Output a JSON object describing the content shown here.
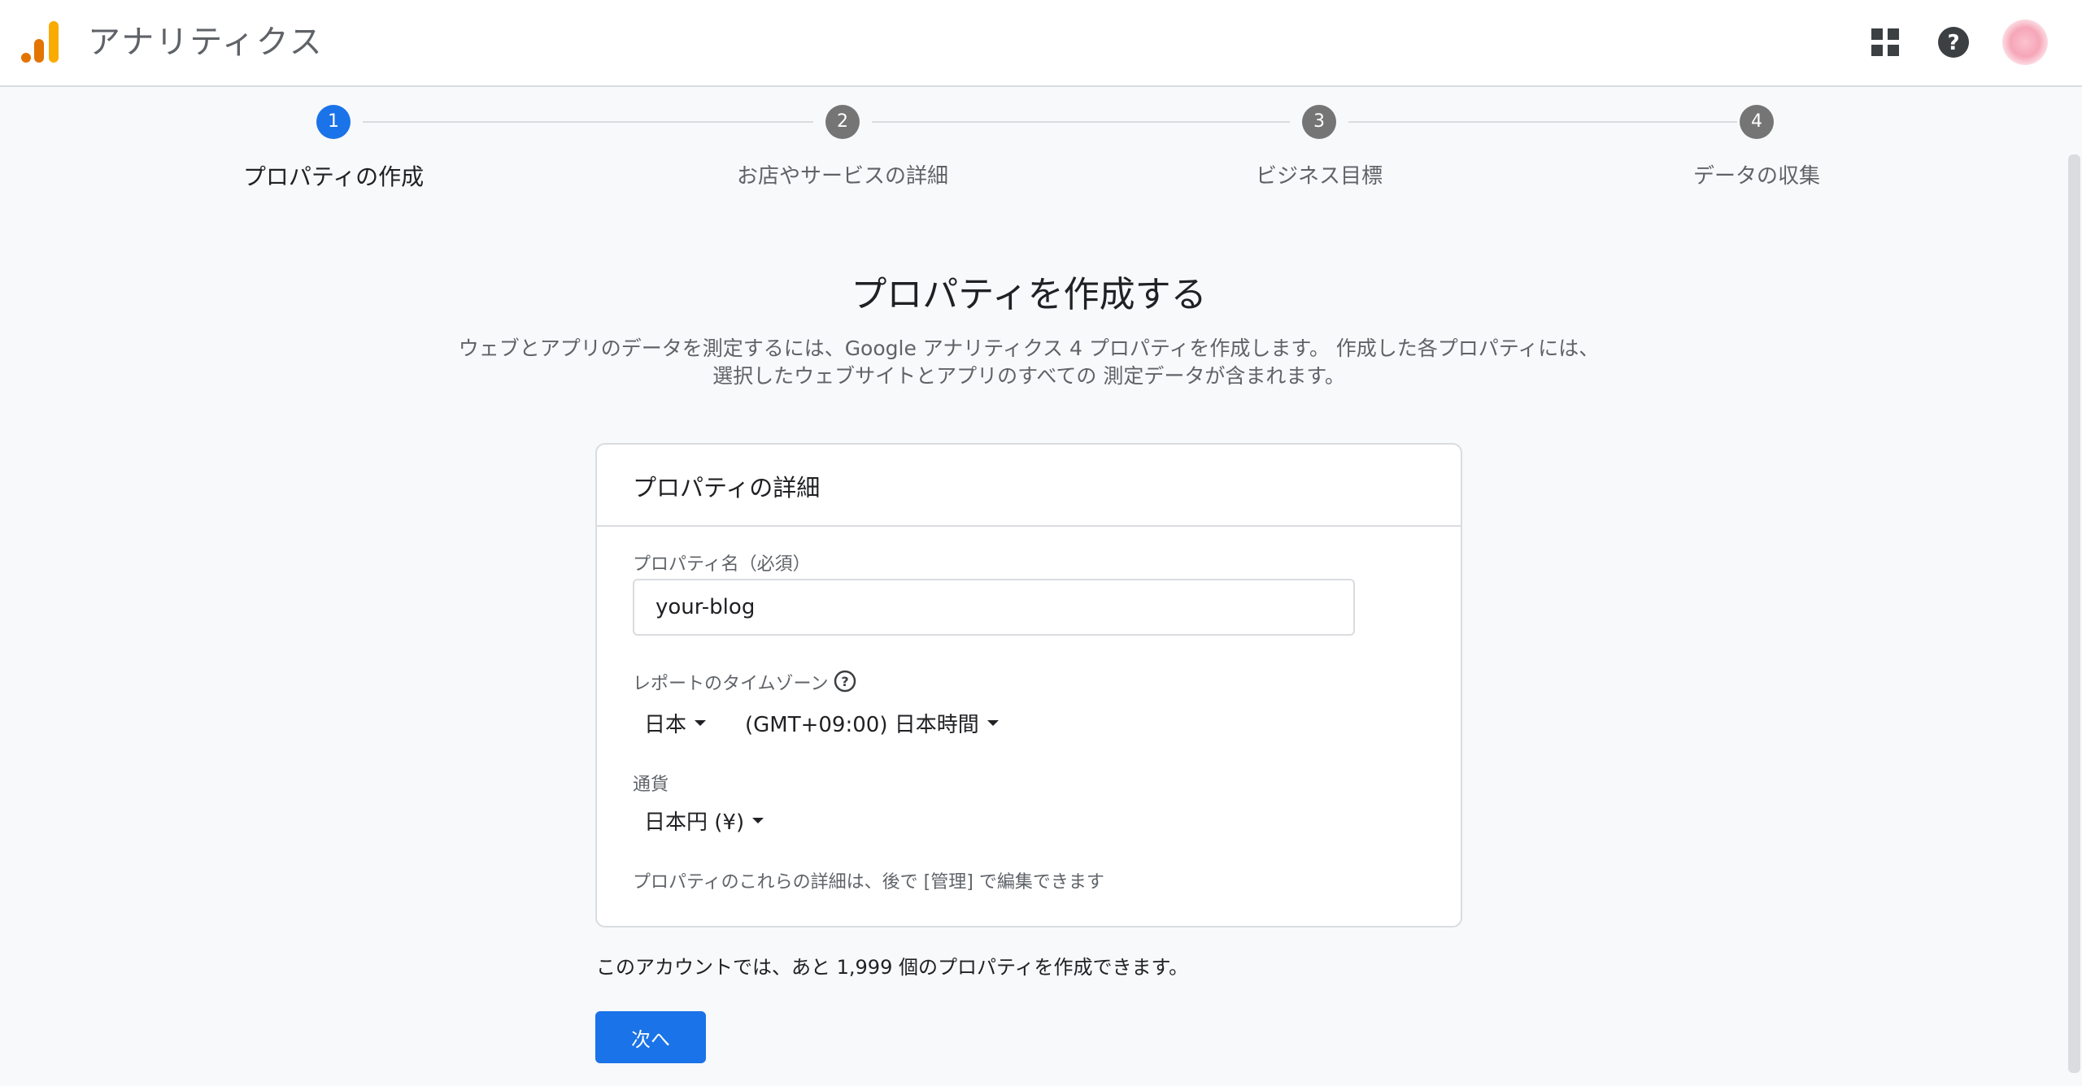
{
  "header": {
    "title": "アナリティクス",
    "icons": {
      "logo": "analytics-logo-icon",
      "apps": "apps-grid-icon",
      "help": "help-icon",
      "avatar": "avatar"
    }
  },
  "colors": {
    "accent": "#1a73e8",
    "logo_orange": "#f9ab00",
    "logo_dark": "#e37400",
    "step_inactive": "#757575"
  },
  "stepper": {
    "steps": [
      {
        "number": "1",
        "label": "プロパティの作成",
        "active": true
      },
      {
        "number": "2",
        "label": "お店やサービスの詳細",
        "active": false
      },
      {
        "number": "3",
        "label": "ビジネス目標",
        "active": false
      },
      {
        "number": "4",
        "label": "データの収集",
        "active": false
      }
    ]
  },
  "main": {
    "title": "プロパティを作成する",
    "description_line1": "ウェブとアプリのデータを測定するには、Google アナリティクス 4 プロパティを作成します。 作成した各プロパティには、",
    "description_line2": "選択したウェブサイトとアプリのすべての 測定データが含まれます。"
  },
  "card": {
    "title": "プロパティの詳細",
    "property_name_label": "プロパティ名（必須）",
    "property_name_value": "your-blog",
    "timezone_label": "レポートのタイムゾーン",
    "timezone_country": "日本",
    "timezone_value": "(GMT+09:00) 日本時間",
    "currency_label": "通貨",
    "currency_value": "日本円 (¥)",
    "note": "プロパティのこれらの詳細は、後で [管理] で編集できます"
  },
  "quota_text": "このアカウントでは、あと 1,999 個のプロパティを作成できます。",
  "next_button": "次へ"
}
